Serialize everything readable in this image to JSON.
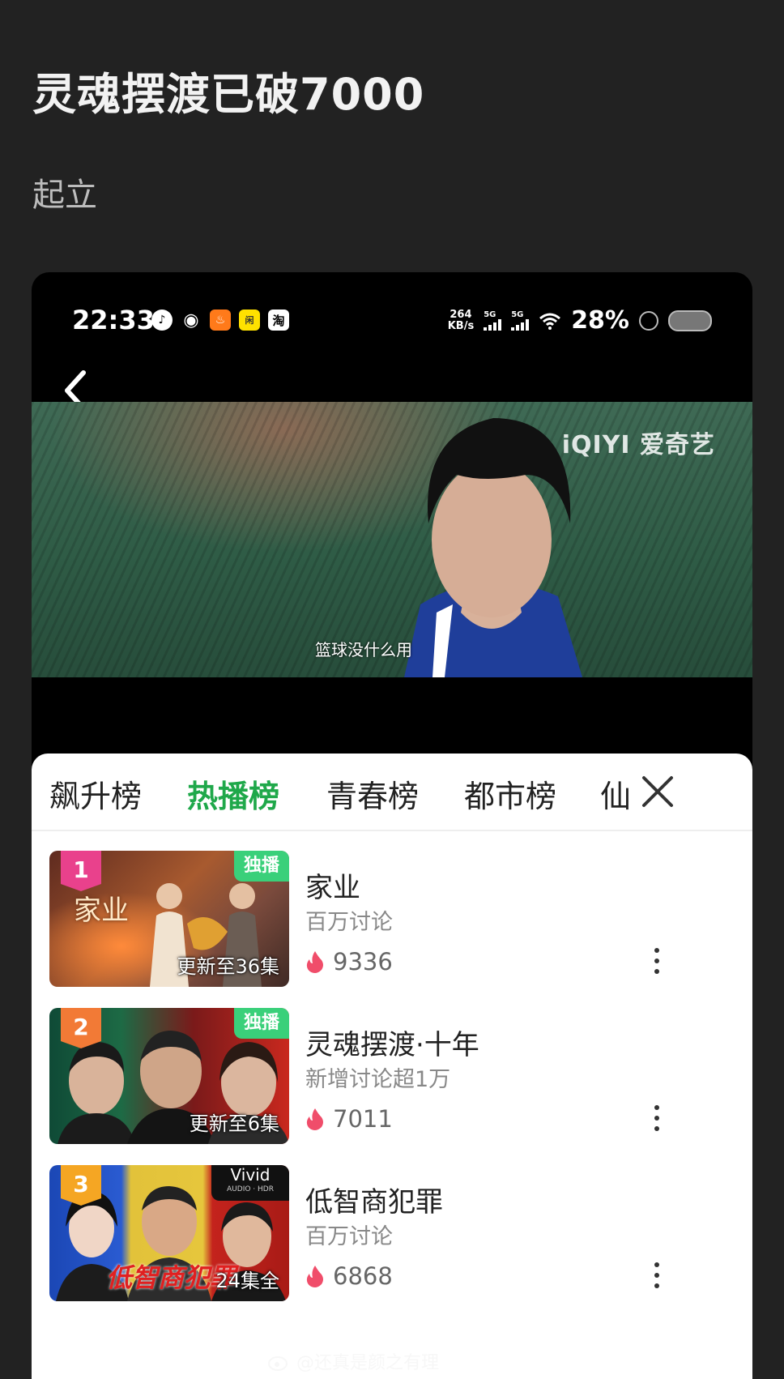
{
  "post": {
    "title": "灵魂摆渡已破7000",
    "subtitle": "起立"
  },
  "statusbar": {
    "time": "22:33",
    "apps": [
      "tiktok-icon",
      "weibo-icon",
      "store-icon",
      "xianyu-icon",
      "taobao-icon"
    ],
    "speed_value": "264",
    "speed_unit": "KB/s",
    "net1": "5G",
    "net2": "5G",
    "battery_pct": "28%"
  },
  "video": {
    "watermark": "iQIYI 爱奇艺",
    "subtitle": "篮球没什么用"
  },
  "tabs": [
    {
      "label": "飙升榜",
      "active": false
    },
    {
      "label": "热播榜",
      "active": true
    },
    {
      "label": "青春榜",
      "active": false
    },
    {
      "label": "都市榜",
      "active": false
    },
    {
      "label": "仙",
      "active": false
    }
  ],
  "list": [
    {
      "rank": "1",
      "rank_color": "#e9418c",
      "badge": "独播",
      "thumb_text": "家业",
      "episodes": "更新至36集",
      "title": "家业",
      "desc": "百万讨论",
      "heat": "9336"
    },
    {
      "rank": "2",
      "rank_color": "#f27a36",
      "badge": "独播",
      "episodes": "更新至6集",
      "title": "灵魂摆渡·十年",
      "desc": "新增讨论超1万",
      "heat": "7011"
    },
    {
      "rank": "3",
      "rank_color": "#f5a623",
      "badge_vivid": "Vivid",
      "badge_vivid_sub": "AUDIO · HDR",
      "thumb_text": "低智商犯罪",
      "episodes": "24集全",
      "title": "低智商犯罪",
      "desc": "百万讨论",
      "heat": "6868"
    }
  ],
  "credit": "@还真是颜之有理",
  "colors": {
    "accent": "#1fa84a",
    "heat": "#f04d6a",
    "exclusive": "#3ad07a"
  }
}
